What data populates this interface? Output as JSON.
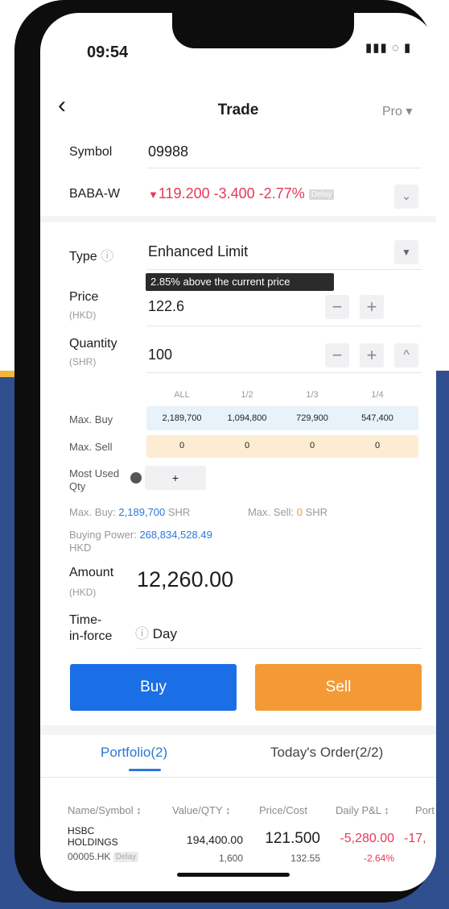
{
  "status_bar": {
    "time": "09:54",
    "icons": "▮▮▮ ◌ ▮"
  },
  "nav": {
    "title": "Trade",
    "pro_label": "Pro ▾",
    "back_glyph": "‹"
  },
  "symbol": {
    "label": "Symbol",
    "value": "09988"
  },
  "quote": {
    "name": "BABA-W",
    "arrow": "▼",
    "price": "119.200",
    "change": "-3.400",
    "change_pct": "-2.77%",
    "badge": "Delay"
  },
  "order_type": {
    "label": "Type",
    "info_glyph": "ⓘ",
    "value": "Enhanced Limit"
  },
  "price": {
    "label": "Price",
    "unit": "(HKD)",
    "value": "122.6",
    "tooltip": "2.85% above the current price"
  },
  "quantity": {
    "label": "Quantity",
    "unit": "(SHR)",
    "value": "100"
  },
  "stepper": {
    "minus": "−",
    "plus": "+",
    "up": "^"
  },
  "qty_grid": {
    "headers": [
      "ALL",
      "1/2",
      "1/3",
      "1/4"
    ],
    "max_buy": {
      "label": "Max. Buy",
      "values": [
        "2,189,700",
        "1,094,800",
        "729,900",
        "547,400"
      ]
    },
    "max_sell": {
      "label": "Max. Sell",
      "values": [
        "0",
        "0",
        "0",
        "0"
      ]
    }
  },
  "most_used": {
    "label": "Most Used Qty",
    "add": "+"
  },
  "summary": {
    "max_buy_label": "Max. Buy: ",
    "max_buy_value": "2,189,700",
    "max_buy_unit": " SHR",
    "max_sell_label": "Max. Sell: ",
    "max_sell_value": "0",
    "max_sell_unit": " SHR",
    "buying_power_label": "Buying Power: ",
    "buying_power_value": "268,834,528.49",
    "buying_power_unit": "HKD"
  },
  "amount": {
    "label": "Amount",
    "unit": "(HKD)",
    "value": "12,260.00"
  },
  "tif": {
    "label_line1": "Time-",
    "label_line2": "in-force",
    "info_glyph": "ⓘ",
    "value": "Day"
  },
  "actions": {
    "buy": "Buy",
    "sell": "Sell"
  },
  "tabs": {
    "portfolio": "Portfolio(2)",
    "orders": "Today's Order(2/2)"
  },
  "table": {
    "headers": [
      "Name/Symbol ↕",
      "Value/QTY ↕",
      "Price/Cost",
      "Daily P&L ↕",
      "Port"
    ],
    "row": {
      "name_line1": "HSBC",
      "name_line2": "HOLDINGS",
      "symbol": "00005.HK",
      "badge": "Delay",
      "value": "194,400.00",
      "qty": "1,600",
      "price": "121.500",
      "cost": "132.55",
      "pnl": "-5,280.00",
      "pnl_pct": "-2.64%",
      "port": "-17,"
    }
  },
  "colors": {
    "accent_blue": "#1a6fe6",
    "sell_orange": "#f39a36",
    "down_red": "#e8375a"
  }
}
